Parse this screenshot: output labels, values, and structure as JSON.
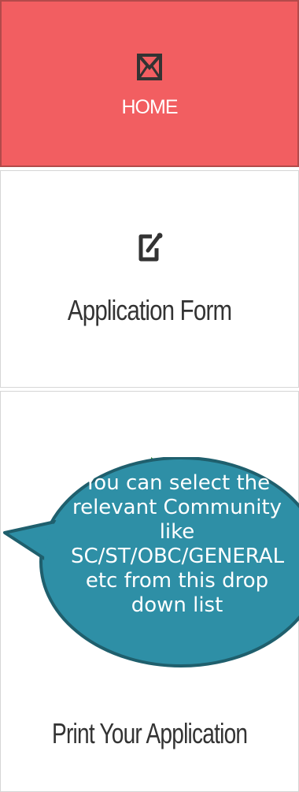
{
  "nav": {
    "home": {
      "label": "HOME",
      "icon": "envelope-icon"
    },
    "application_form": {
      "label": "Application Form",
      "icon": "edit-icon"
    },
    "edit_application": {
      "icon": "swap-arrows-icon"
    },
    "print_application": {
      "label": "Print Your Application"
    }
  },
  "callout": {
    "text": "You can select the relevant Community like SC/ST/OBC/GENERAL etc from this drop down list"
  },
  "colors": {
    "home_bg": "#f25e61",
    "callout_fill": "#2e8fa6",
    "callout_border": "#1f5f6d",
    "swap_icon": "#2e8b2e"
  }
}
